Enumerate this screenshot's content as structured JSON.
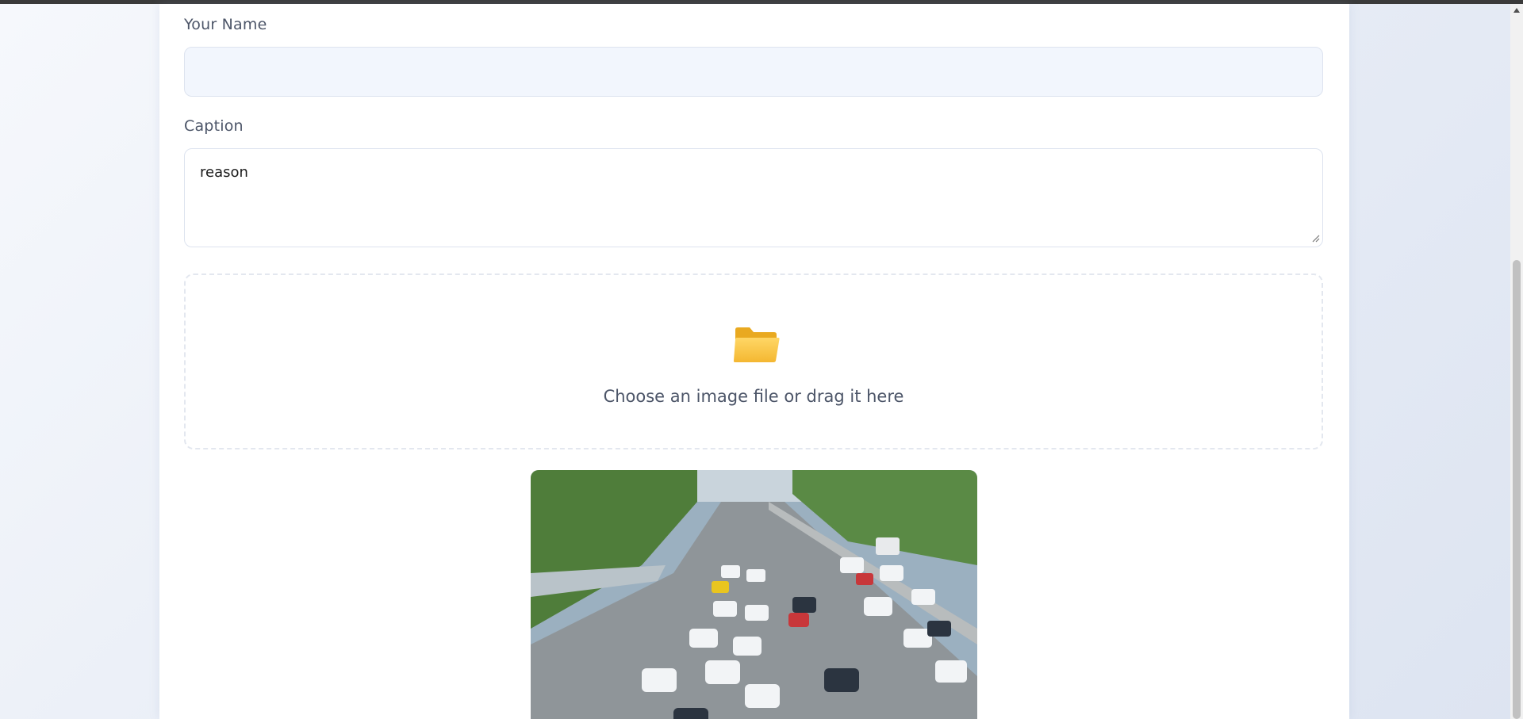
{
  "form": {
    "name_label": "Your Name",
    "name_value": "",
    "caption_label": "Caption",
    "caption_value": "reason",
    "dropzone_text": "Choose an image file or drag it here",
    "dropzone_icon": "folder-icon",
    "preview_icon": "image-preview"
  },
  "colors": {
    "accent_folder": "#f6c343",
    "label": "#4c5568",
    "input_border": "#dde3ef"
  }
}
